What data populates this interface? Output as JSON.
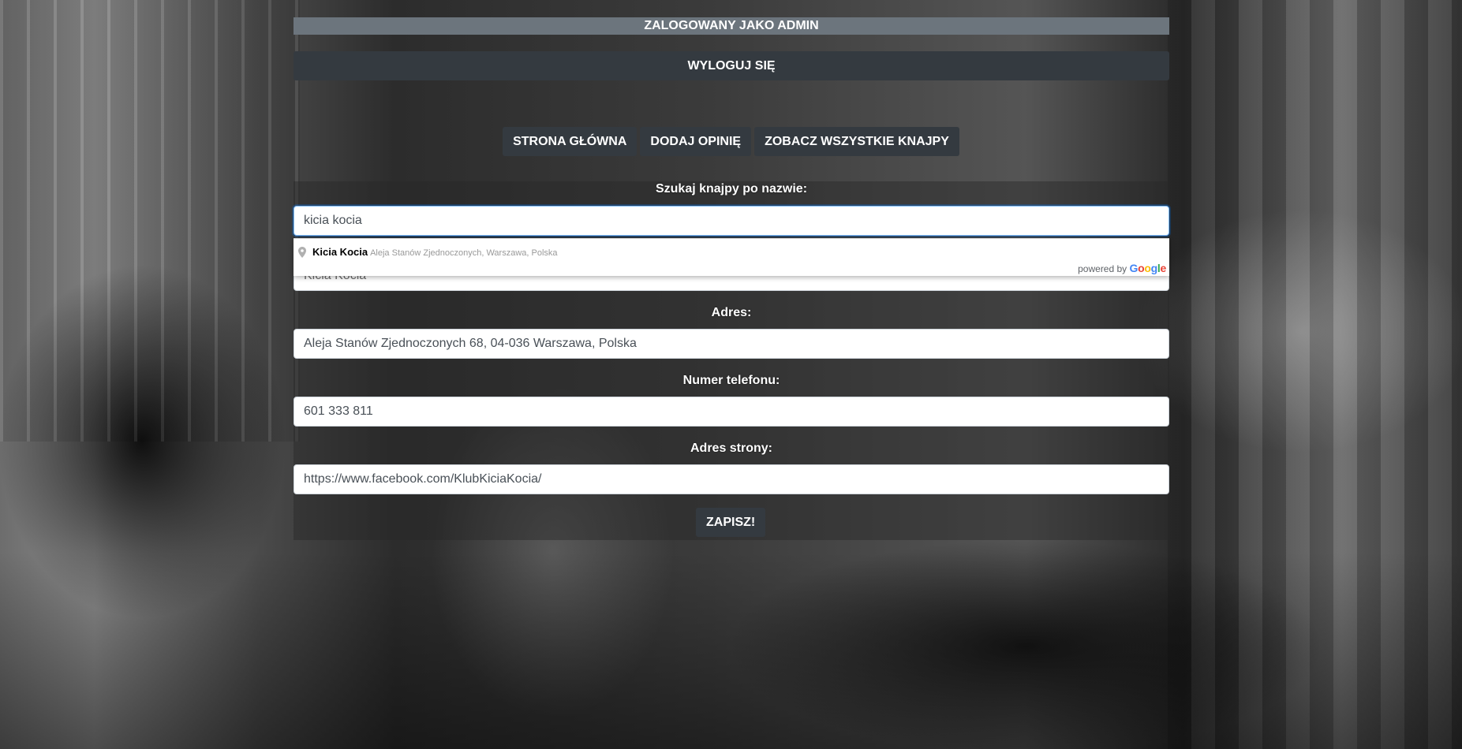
{
  "header": {
    "logged_in_label": "ZALOGOWANY JAKO ADMIN",
    "logout_label": "WYLOGUJ SIĘ"
  },
  "nav": {
    "items": [
      {
        "label": "STRONA GŁÓWNA"
      },
      {
        "label": "DODAJ OPINIĘ"
      },
      {
        "label": "ZOBACZ WSZYSTKIE KNAJPY"
      }
    ]
  },
  "form": {
    "search_label": "Szukaj knajpy po nazwie:",
    "search_value": "kicia kocia",
    "name_value": "Kicia Kocia",
    "address_label": "Adres:",
    "address_value": "Aleja Stanów Zjednoczonych 68, 04-036 Warszawa, Polska",
    "phone_label": "Numer telefonu:",
    "phone_value": "601 333 811",
    "website_label": "Adres strony:",
    "website_value": "https://www.facebook.com/KlubKiciaKocia/",
    "save_label": "ZAPISZ!"
  },
  "autocomplete": {
    "suggestions": [
      {
        "main": "Kicia Kocia",
        "secondary": "Aleja Stanów Zjednoczonych, Warszawa, Polska",
        "icon": "map-pin-icon"
      }
    ],
    "powered_by": "powered by",
    "brand": "Google"
  },
  "colors": {
    "header_bar": "#6c757d",
    "button_dark": "#343a40",
    "focus_border": "#80bdff"
  }
}
